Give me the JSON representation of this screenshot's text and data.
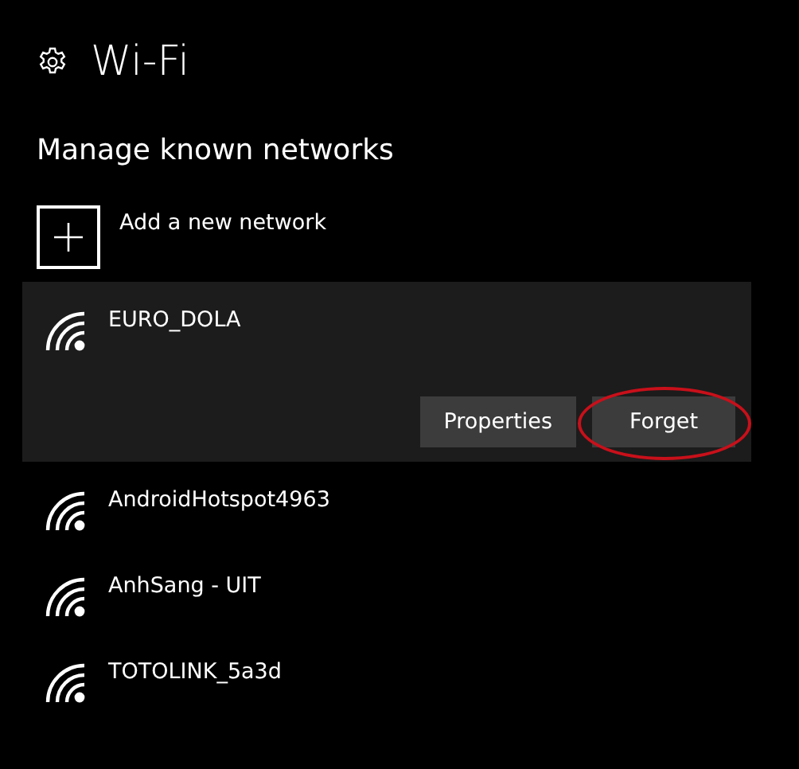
{
  "header": {
    "title": "Wi-Fi"
  },
  "section_title": "Manage known networks",
  "add_network": {
    "label": "Add a new network"
  },
  "networks": [
    {
      "name": "EURO_DOLA",
      "selected": true
    },
    {
      "name": "AndroidHotspot4963",
      "selected": false
    },
    {
      "name": "AnhSang - UIT",
      "selected": false
    },
    {
      "name": "TOTOLINK_5a3d",
      "selected": false
    }
  ],
  "actions": [
    {
      "label": "Properties",
      "circled": false
    },
    {
      "label": "Forget",
      "circled": true
    }
  ]
}
